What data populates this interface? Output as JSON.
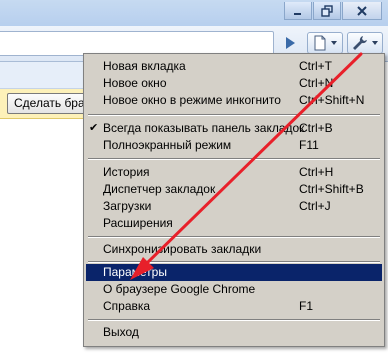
{
  "window": {
    "controls": [
      "minimize-icon",
      "restore-icon",
      "close-icon"
    ]
  },
  "toolbar": {
    "icons": [
      "play-arrow-icon",
      "page-icon",
      "wrench-icon"
    ]
  },
  "infobar": {
    "button_label": "Сделать брау"
  },
  "menu": {
    "items": [
      {
        "label": "Новая вкладка",
        "shortcut": "Ctrl+T"
      },
      {
        "label": "Новое окно",
        "shortcut": "Ctrl+N"
      },
      {
        "label": "Новое окно в режиме инкогнито",
        "shortcut": "Ctrl+Shift+N"
      },
      {
        "label": "Всегда показывать панель закладок",
        "shortcut": "Ctrl+B",
        "checked": true
      },
      {
        "label": "Полноэкранный режим",
        "shortcut": "F11"
      },
      {
        "label": "История",
        "shortcut": "Ctrl+H"
      },
      {
        "label": "Диспетчер закладок",
        "shortcut": "Ctrl+Shift+B"
      },
      {
        "label": "Загрузки",
        "shortcut": "Ctrl+J"
      },
      {
        "label": "Расширения",
        "shortcut": ""
      },
      {
        "label": "Синхронизировать закладки",
        "shortcut": ""
      },
      {
        "label": "Параметры",
        "shortcut": "",
        "highlighted": true
      },
      {
        "label": "О браузере Google Chrome",
        "shortcut": ""
      },
      {
        "label": "Справка",
        "shortcut": "F1"
      },
      {
        "label": "Выход",
        "shortcut": ""
      }
    ],
    "check_mark": "✔"
  },
  "colors": {
    "menu_background": "#d4d0c8",
    "menu_highlight": "#0a246a",
    "annotation_arrow": "#e8202a"
  }
}
